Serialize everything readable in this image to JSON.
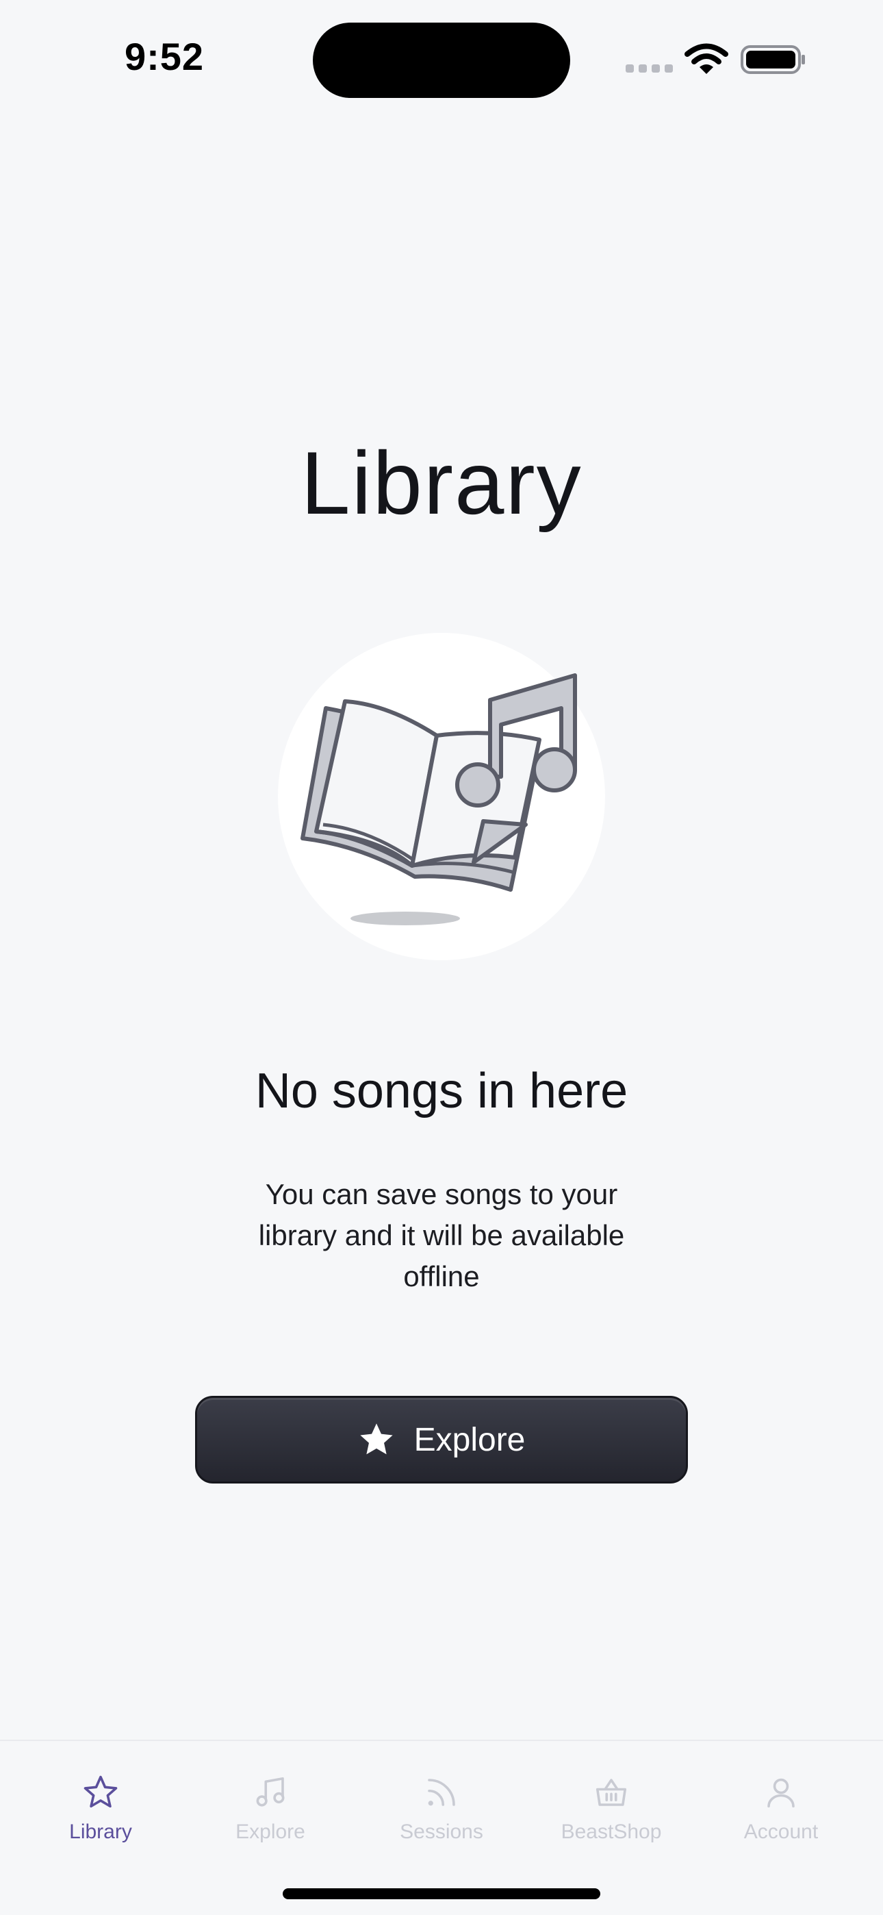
{
  "status_bar": {
    "time": "9:52"
  },
  "page": {
    "title": "Library"
  },
  "empty_state": {
    "heading": "No songs in here",
    "description": "You can save songs to your library and it will be available offline"
  },
  "explore_button": {
    "label": "Explore",
    "icon": "star-icon"
  },
  "tab_bar": {
    "items": [
      {
        "label": "Library",
        "icon": "star-icon",
        "active": true
      },
      {
        "label": "Explore",
        "icon": "music-note-icon",
        "active": false
      },
      {
        "label": "Sessions",
        "icon": "rss-icon",
        "active": false
      },
      {
        "label": "BeastShop",
        "icon": "basket-icon",
        "active": false
      },
      {
        "label": "Account",
        "icon": "user-icon",
        "active": false
      }
    ]
  },
  "colors": {
    "background": "#f6f7f9",
    "active_tab": "#5b4f9c",
    "inactive_tab": "#c9cbd3",
    "button_bg": "#2b2d36",
    "text": "#14151a"
  }
}
